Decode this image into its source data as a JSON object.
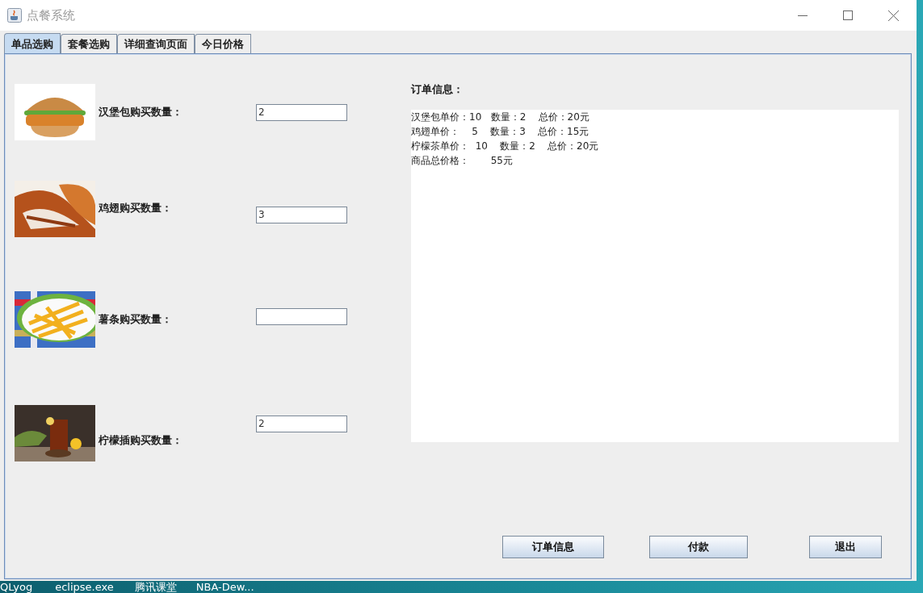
{
  "window": {
    "title": "点餐系统"
  },
  "tabs": [
    {
      "label": "单品选购",
      "selected": true
    },
    {
      "label": "套餐选购",
      "selected": false
    },
    {
      "label": "详细查询页面",
      "selected": false
    },
    {
      "label": "今日价格",
      "selected": false
    }
  ],
  "items": [
    {
      "label": "汉堡包购买数量：",
      "value": "2"
    },
    {
      "label": "鸡翅购买数量：",
      "value": "3"
    },
    {
      "label": "薯条购买数量："
    },
    {
      "label": "柠檬插购买数量：",
      "value": "2"
    }
  ],
  "order": {
    "title": "订单信息：",
    "lines": [
      "汉堡包单价：10   数量：2    总价：20元",
      "鸡翅单价：    5    数量：3    总价：15元",
      "柠檬茶单价：  10    数量：2    总价：20元",
      "商品总价格：       55元"
    ]
  },
  "buttons": [
    "订单信息",
    "付款",
    "退出"
  ],
  "desktop_labels": [
    "QLyog",
    "eclipse.exe",
    "腾讯课堂",
    "NBA-Dew..."
  ]
}
